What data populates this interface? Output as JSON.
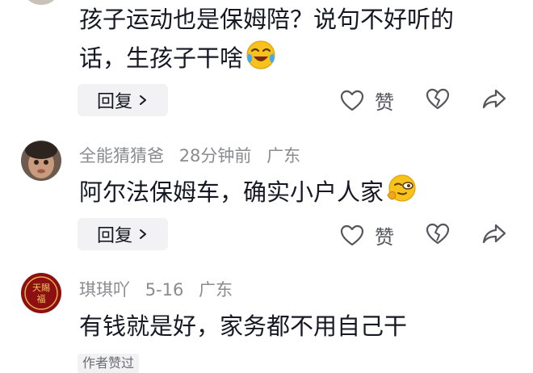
{
  "comments": [
    {
      "text": "孩子运动也是保姆陪？说句不好听的话，生孩子干啥",
      "emoji": "crying-laugh-emoji",
      "reply_label": "回复",
      "like_label": "赞"
    },
    {
      "username": "全能猜猜爸",
      "time": "28分钟前",
      "location": "广东",
      "text": "阿尔法保姆车，确实小户人家",
      "emoji": "smug-sunglasses-emoji",
      "reply_label": "回复",
      "like_label": "赞"
    },
    {
      "username": "琪琪吖",
      "time": "5-16",
      "location": "广东",
      "text": "有钱就是好，家务都不用自己干",
      "badge": "作者赞过"
    }
  ],
  "colors": {
    "text": "#161823",
    "meta": "#8a8b91",
    "icon": "#55565c",
    "pill": "#f2f2f4"
  }
}
